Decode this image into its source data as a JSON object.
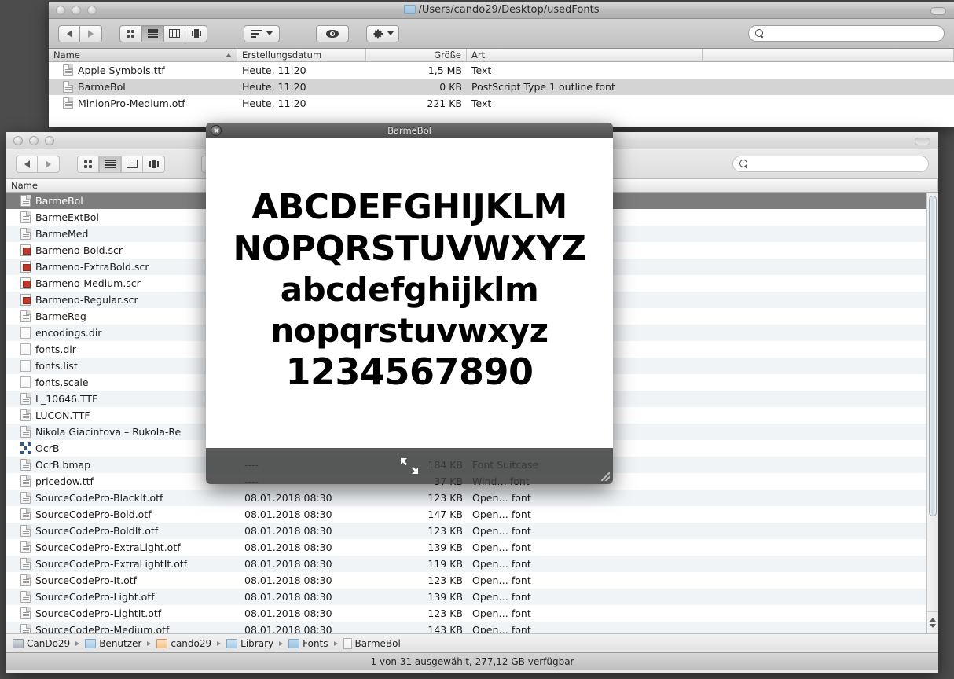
{
  "desktop": {
    "background": "#4c4c4c"
  },
  "window_top": {
    "title": "/Users/cando29/Desktop/usedFonts",
    "title_icon": "folder-icon",
    "traffic_lights": [
      "close-button",
      "minimize-button",
      "zoom-button"
    ],
    "toolbar": {
      "back_label": "back-arrow-icon",
      "forward_label": "forward-arrow-icon",
      "view_icon": "icon-view-icon",
      "view_list": "list-view-icon",
      "view_columns": "column-view-icon",
      "view_coverflow": "coverflow-view-icon",
      "arrange_label": "arrange-icon",
      "quicklook_label": "eye-icon",
      "action_label": "gear-icon"
    },
    "search": {
      "value": "",
      "placeholder": ""
    },
    "columns": [
      "Name",
      "Erstellungsdatum",
      "Größe",
      "Art"
    ],
    "sorted_column": "Name",
    "rows": [
      {
        "name": "Apple Symbols.ttf",
        "date": "Heute, 11:20",
        "size": "1,5 MB",
        "kind": "Text",
        "icon": "font-file-icon",
        "selected": false
      },
      {
        "name": "BarmeBol",
        "date": "Heute, 11:20",
        "size": "0 KB",
        "kind": "PostScript Type 1 outline font",
        "icon": "font-file-icon",
        "selected": true
      },
      {
        "name": "MinionPro-Medium.otf",
        "date": "Heute, 11:20",
        "size": "221 KB",
        "kind": "Text",
        "icon": "font-file-icon",
        "selected": false
      }
    ]
  },
  "window_bottom": {
    "title": "",
    "traffic_lights": [
      "close-button",
      "minimize-button",
      "zoom-button"
    ],
    "toolbar": {
      "back_label": "back-arrow-icon",
      "forward_label": "forward-arrow-icon",
      "view_icon": "icon-view-icon",
      "view_list": "list-view-icon",
      "view_columns": "column-view-icon",
      "view_coverflow": "coverflow-view-icon",
      "arrange_label": "arrange-icon"
    },
    "search": {
      "value": "",
      "placeholder": ""
    },
    "columns": [
      "Name"
    ],
    "rows": [
      {
        "name": "BarmeBol",
        "date": "",
        "size": "",
        "kind": "",
        "icon": "font-file-icon",
        "selected": true
      },
      {
        "name": "BarmeExtBol",
        "date": "",
        "size": "",
        "kind": "",
        "icon": "font-file-icon",
        "selected": false
      },
      {
        "name": "BarmeMed",
        "date": "",
        "size": "",
        "kind": "",
        "icon": "font-file-icon",
        "selected": false
      },
      {
        "name": "Barmeno-Bold.scr",
        "date": "",
        "size": "",
        "kind": "",
        "icon": "script-file-icon",
        "selected": false
      },
      {
        "name": "Barmeno-ExtraBold.scr",
        "date": "",
        "size": "",
        "kind": "",
        "icon": "script-file-icon",
        "selected": false
      },
      {
        "name": "Barmeno-Medium.scr",
        "date": "",
        "size": "",
        "kind": "",
        "icon": "script-file-icon",
        "selected": false
      },
      {
        "name": "Barmeno-Regular.scr",
        "date": "",
        "size": "",
        "kind": "",
        "icon": "script-file-icon",
        "selected": false
      },
      {
        "name": "BarmeReg",
        "date": "",
        "size": "",
        "kind": "",
        "icon": "font-file-icon",
        "selected": false
      },
      {
        "name": "encodings.dir",
        "date": "",
        "size": "",
        "kind": "",
        "icon": "plain-file-icon",
        "selected": false
      },
      {
        "name": "fonts.dir",
        "date": "",
        "size": "",
        "kind": "",
        "icon": "plain-file-icon",
        "selected": false
      },
      {
        "name": "fonts.list",
        "date": "",
        "size": "",
        "kind": "",
        "icon": "plain-file-icon",
        "selected": false
      },
      {
        "name": "fonts.scale",
        "date": "",
        "size": "",
        "kind": "",
        "icon": "plain-file-icon",
        "selected": false
      },
      {
        "name": "L_10646.TTF",
        "date": "",
        "size": "",
        "kind": "",
        "icon": "font-file-icon",
        "selected": false
      },
      {
        "name": "LUCON.TTF",
        "date": "",
        "size": "",
        "kind": "",
        "icon": "font-file-icon",
        "selected": false
      },
      {
        "name": "Nikola Giacintova  – Rukola-Re",
        "date": "",
        "size": "",
        "kind": "",
        "icon": "font-file-icon",
        "selected": false
      },
      {
        "name": "OcrB",
        "date": "",
        "size": "",
        "kind": "",
        "icon": "font-suitcase-icon",
        "selected": false
      },
      {
        "name": "OcrB.bmap",
        "date": "----",
        "size": "184 KB",
        "kind": "Font Suitcase",
        "icon": "font-file-icon",
        "selected": false
      },
      {
        "name": "pricedow.ttf",
        "date": "----",
        "size": "37 KB",
        "kind": "Wind… font",
        "icon": "font-file-icon",
        "selected": false
      },
      {
        "name": "SourceCodePro-BlackIt.otf",
        "date": "08.01.2018 08:30",
        "size": "123 KB",
        "kind": "Open… font",
        "icon": "font-file-icon",
        "selected": false
      },
      {
        "name": "SourceCodePro-Bold.otf",
        "date": "08.01.2018 08:30",
        "size": "147 KB",
        "kind": "Open… font",
        "icon": "font-file-icon",
        "selected": false
      },
      {
        "name": "SourceCodePro-BoldIt.otf",
        "date": "08.01.2018 08:30",
        "size": "123 KB",
        "kind": "Open… font",
        "icon": "font-file-icon",
        "selected": false
      },
      {
        "name": "SourceCodePro-ExtraLight.otf",
        "date": "08.01.2018 08:30",
        "size": "139 KB",
        "kind": "Open… font",
        "icon": "font-file-icon",
        "selected": false
      },
      {
        "name": "SourceCodePro-ExtraLightIt.otf",
        "date": "08.01.2018 08:30",
        "size": "119 KB",
        "kind": "Open… font",
        "icon": "font-file-icon",
        "selected": false
      },
      {
        "name": "SourceCodePro-It.otf",
        "date": "08.01.2018 08:30",
        "size": "123 KB",
        "kind": "Open… font",
        "icon": "font-file-icon",
        "selected": false
      },
      {
        "name": "SourceCodePro-Light.otf",
        "date": "08.01.2018 08:30",
        "size": "139 KB",
        "kind": "Open… font",
        "icon": "font-file-icon",
        "selected": false
      },
      {
        "name": "SourceCodePro-LightIt.otf",
        "date": "08.01.2018 08:30",
        "size": "123 KB",
        "kind": "Open… font",
        "icon": "font-file-icon",
        "selected": false
      },
      {
        "name": "SourceCodePro-Medium.otf",
        "date": "08.01.2018 08:30",
        "size": "143 KB",
        "kind": "Open… font",
        "icon": "font-file-icon",
        "selected": false
      }
    ],
    "pathbar": [
      {
        "label": "CanDo29",
        "icon": "disk-icon"
      },
      {
        "label": "Benutzer",
        "icon": "users-folder-icon"
      },
      {
        "label": "cando29",
        "icon": "home-folder-icon"
      },
      {
        "label": "Library",
        "icon": "library-folder-icon"
      },
      {
        "label": "Fonts",
        "icon": "folder-icon"
      },
      {
        "label": "BarmeBol",
        "icon": "file-icon"
      }
    ],
    "status": "1 von 31 ausgewählt, 277,12 GB verfügbar"
  },
  "quicklook": {
    "title": "BarmeBol",
    "close_label": "close-icon",
    "fullscreen_label": "fullscreen-icon",
    "specimen": [
      "ABCDEFGHIJKLM",
      "NOPQRSTUVWXYZ",
      "abcdefghijklm",
      "nopqrstuvwxyz",
      "1234567890"
    ]
  }
}
